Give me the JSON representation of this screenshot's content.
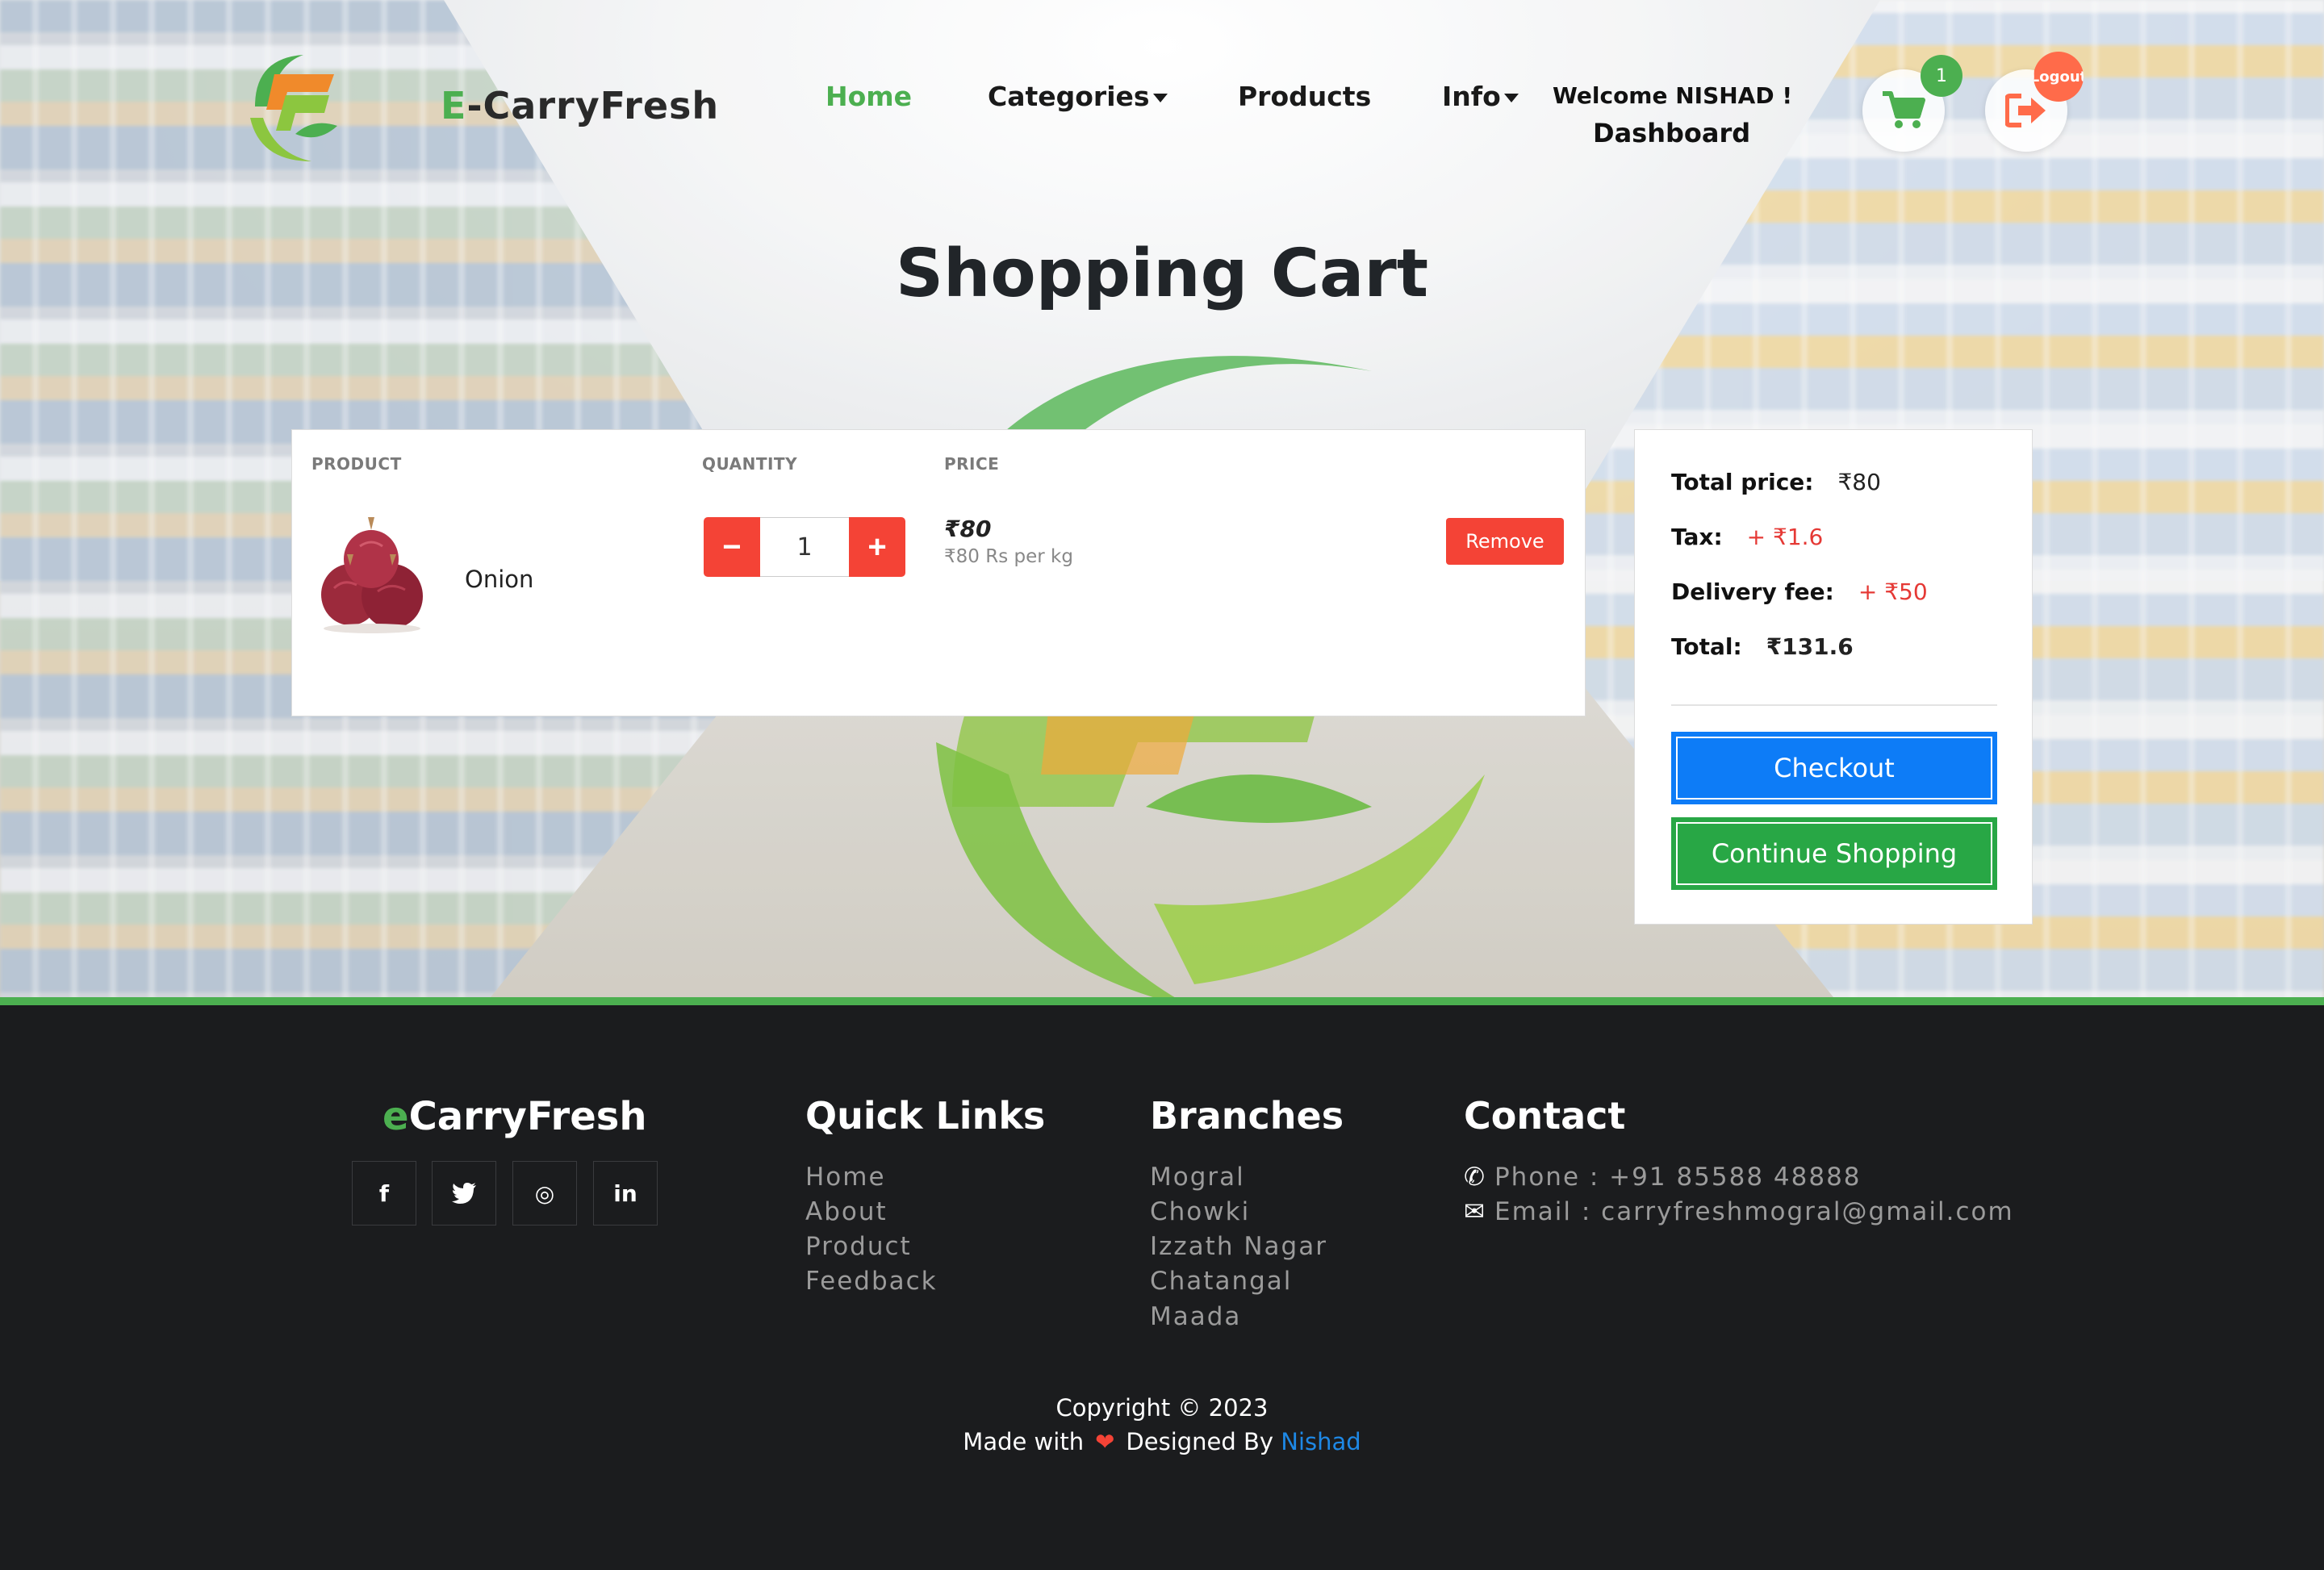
{
  "brand": {
    "prefix": "E",
    "name": "-CarryFresh"
  },
  "nav": {
    "home": "Home",
    "categories": "Categories",
    "products": "Products",
    "info": "Info",
    "welcome": "Welcome NISHAD !",
    "dashboard": "Dashboard",
    "cart_count": "1",
    "logout": "Logout"
  },
  "page_title": "Shopping Cart",
  "cart": {
    "headers": {
      "product": "PRODUCT",
      "quantity": "QUANTITY",
      "price": "PRICE"
    },
    "items": [
      {
        "name": "Onion",
        "quantity": "1",
        "price": "₹80",
        "unit_price": "₹80 Rs per kg",
        "remove_label": "Remove",
        "minus": "−",
        "plus": "+"
      }
    ]
  },
  "summary": {
    "total_price_label": "Total price:",
    "total_price": "₹80",
    "tax_label": "Tax:",
    "tax": "+ ₹1.6",
    "delivery_label": "Delivery fee:",
    "delivery": "+ ₹50",
    "total_label": "Total:",
    "total": "₹131.6",
    "checkout_label": "Checkout",
    "continue_label": "Continue Shopping"
  },
  "footer": {
    "brand_prefix": "e",
    "brand_name": "CarryFresh",
    "social": {
      "facebook": "f",
      "twitter": "t",
      "instagram": "◎",
      "linkedin": "in"
    },
    "quick_links_title": "Quick Links",
    "quick_links": [
      "Home",
      "About",
      "Product",
      "Feedback"
    ],
    "branches_title": "Branches",
    "branches": [
      "Mogral",
      "Chowki",
      "Izzath Nagar",
      "Chatangal",
      "Maada"
    ],
    "contact_title": "Contact",
    "phone": "Phone : +91 85588 48888",
    "email": "Email : carryfreshmogral@gmail.com",
    "copyright": "Copyright © 2023",
    "made_with": "Made with",
    "designed_by": "Designed By",
    "designer": "Nishad"
  },
  "colors": {
    "brand_green": "#4caf50",
    "danger_red": "#f44336",
    "checkout_blue": "#0d7cf7",
    "continue_green": "#28a745",
    "footer_bg": "#1b1c1e"
  }
}
